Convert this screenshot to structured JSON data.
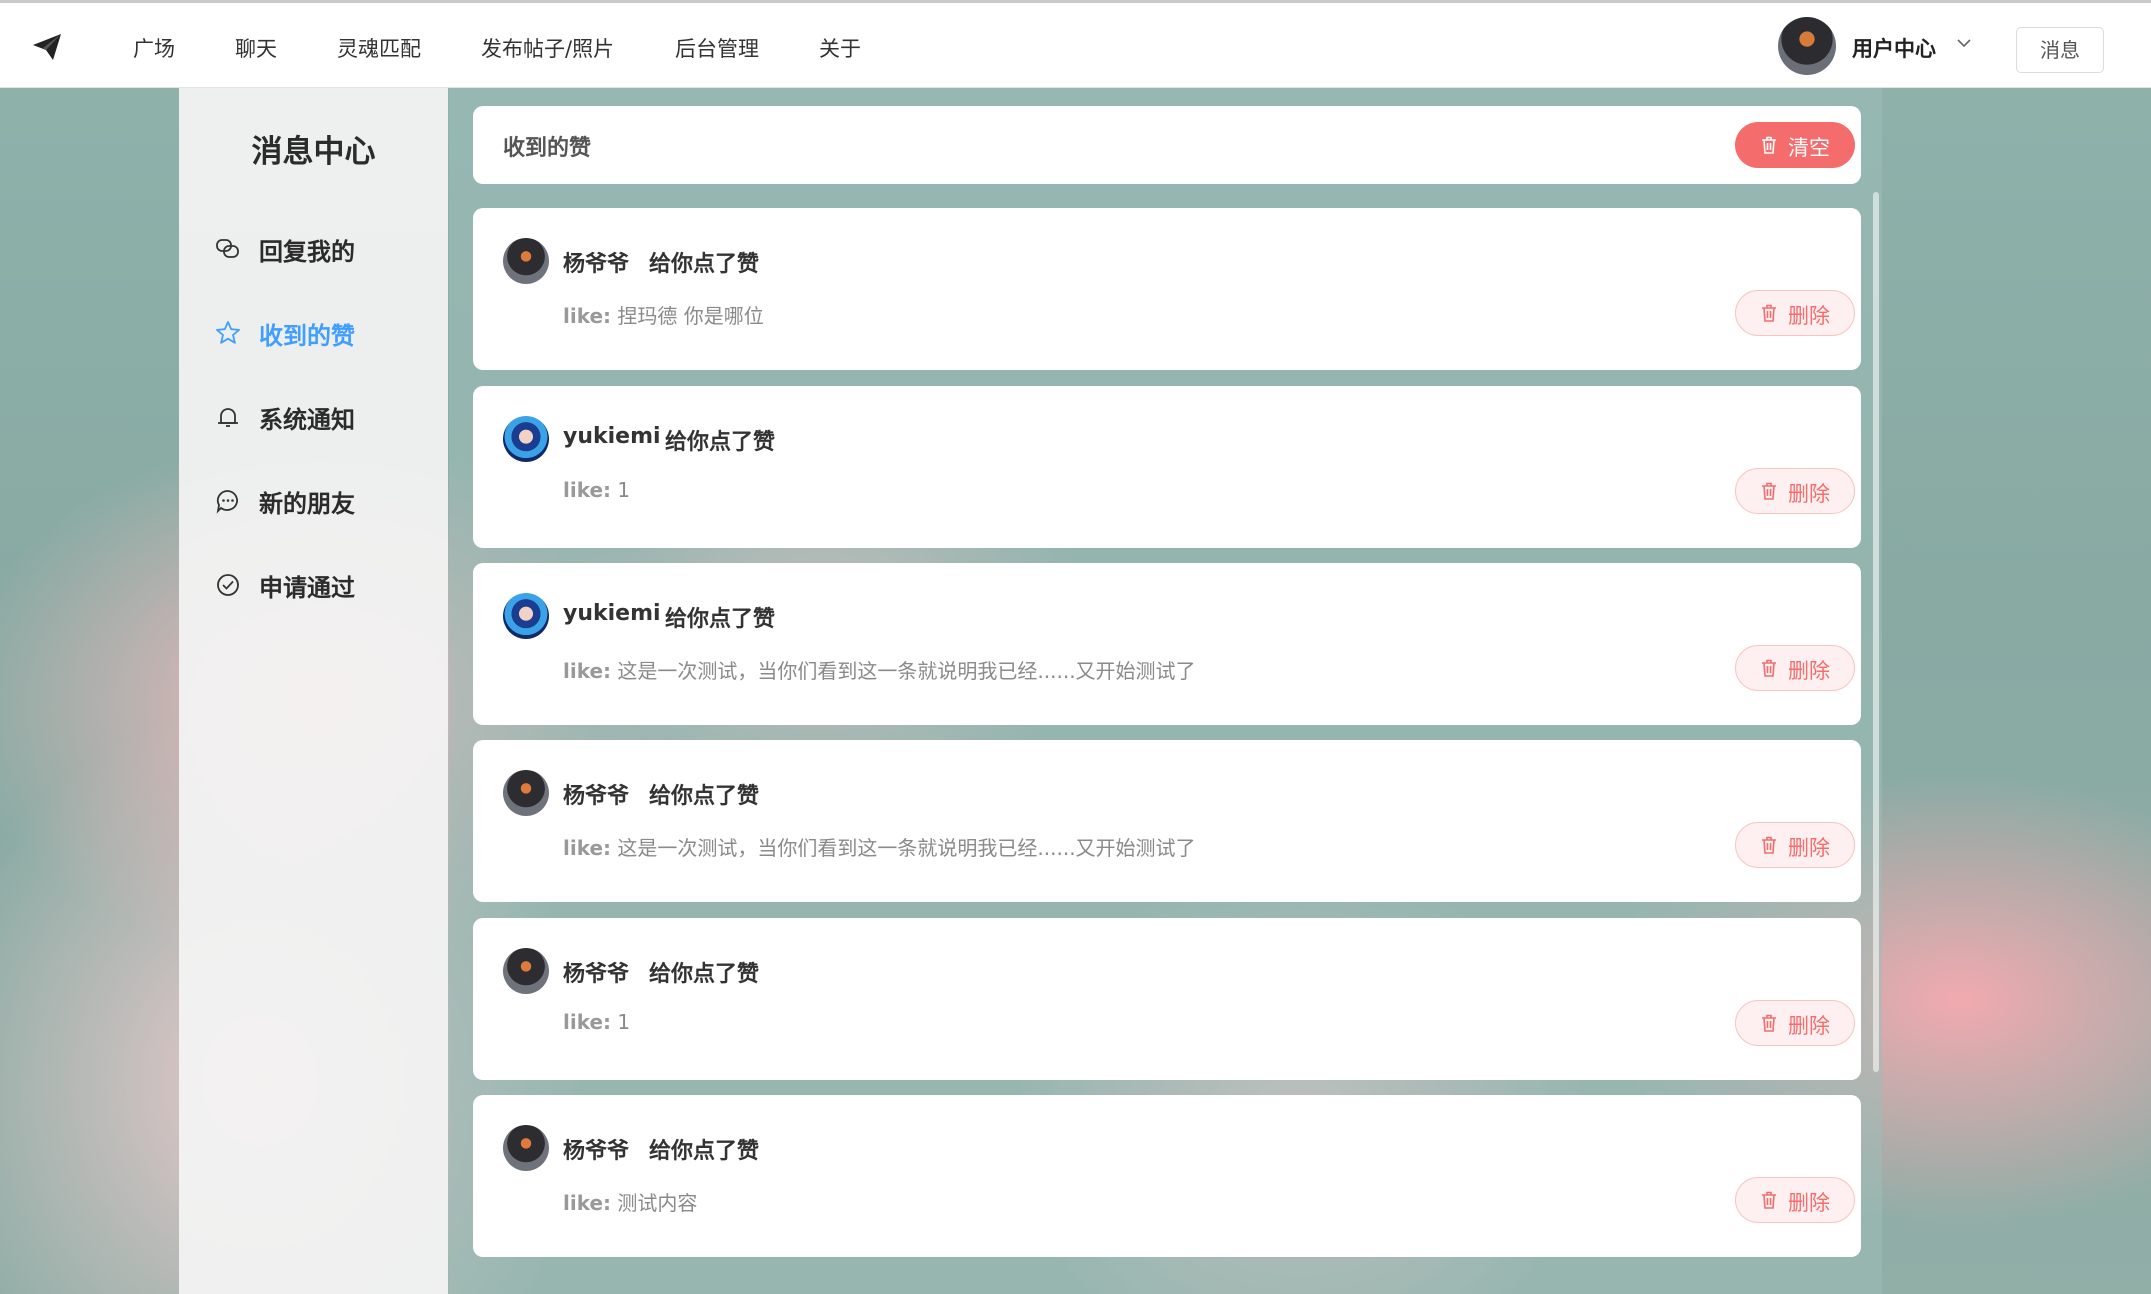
{
  "topbar": {
    "nav": [
      "广场",
      "聊天",
      "灵魂匹配",
      "发布帖子/照片",
      "后台管理",
      "关于"
    ],
    "user_center": "用户中心",
    "message_button": "消息"
  },
  "sidebar": {
    "title": "消息中心",
    "items": [
      {
        "label": "回复我的",
        "icon": "reply-icon"
      },
      {
        "label": "收到的赞",
        "icon": "star-icon",
        "active": true
      },
      {
        "label": "系统通知",
        "icon": "bell-icon"
      },
      {
        "label": "新的朋友",
        "icon": "chat-icon"
      },
      {
        "label": "申请通过",
        "icon": "check-circle-icon"
      }
    ]
  },
  "main": {
    "header_title": "收到的赞",
    "clear_label": "清空",
    "like_prefix": "like:",
    "delete_label": "删除",
    "likes": [
      {
        "user": "杨爷爷",
        "action": "给你点了赞",
        "content": "捏玛德 你是哪位"
      },
      {
        "user": "yukiemi",
        "action": "给你点了赞",
        "content": "1"
      },
      {
        "user": "yukiemi",
        "action": "给你点了赞",
        "content": "这是一次测试，当你们看到这一条就说明我已经......又开始测试了"
      },
      {
        "user": "杨爷爷",
        "action": "给你点了赞",
        "content": "这是一次测试，当你们看到这一条就说明我已经......又开始测试了"
      },
      {
        "user": "杨爷爷",
        "action": "给你点了赞",
        "content": "1"
      },
      {
        "user": "杨爷爷",
        "action": "给你点了赞",
        "content": "测试内容"
      }
    ]
  },
  "colors": {
    "accent": "#409eff",
    "danger": "#f56c6c",
    "danger_light": "#fef0f0"
  }
}
